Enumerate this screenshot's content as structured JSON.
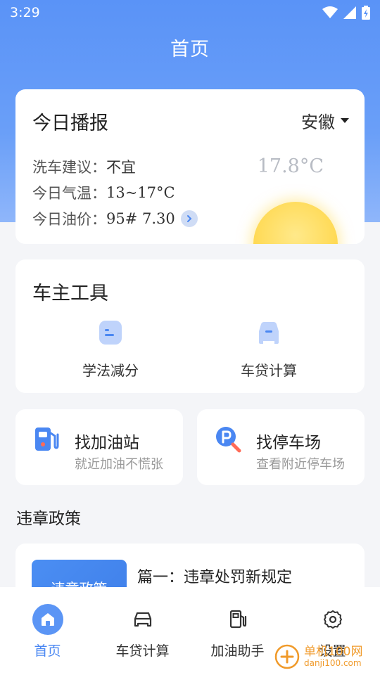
{
  "status_bar": {
    "time": "3:29"
  },
  "header": {
    "title": "首页"
  },
  "report": {
    "title": "今日播报",
    "region": "安徽",
    "wash_label": "洗车建议：",
    "wash_value": "不宜",
    "weather_label": "今日气温：",
    "weather_value": "13~17°C",
    "oil_label": "今日油价：",
    "oil_value": "95# 7.30",
    "temperature": "17.8°C"
  },
  "tools": {
    "title": "车主工具",
    "items": [
      {
        "label": "学法减分",
        "icon": "document-icon"
      },
      {
        "label": "车贷计算",
        "icon": "car-icon"
      }
    ]
  },
  "quick_links": [
    {
      "title": "找加油站",
      "subtitle": "就近加油不慌张",
      "icon": "gas-station-icon"
    },
    {
      "title": "找停车场",
      "subtitle": "查看附近停车场",
      "icon": "parking-search-icon"
    }
  ],
  "policy": {
    "section_title": "违章政策",
    "items": [
      {
        "thumb_text": "违章政策",
        "title": "篇一：违章处罚新规定"
      }
    ]
  },
  "tabbar": {
    "items": [
      {
        "label": "首页",
        "icon": "home-icon",
        "active": true
      },
      {
        "label": "车贷计算",
        "icon": "car-icon"
      },
      {
        "label": "加油助手",
        "icon": "gas-pump-icon"
      },
      {
        "label": "设置",
        "icon": "gear-icon"
      }
    ]
  },
  "watermark": {
    "name": "单机100网",
    "url": "danji100.com"
  },
  "colors": {
    "primary": "#5b95f5",
    "accent_text": "#4a87f2",
    "sun": "#ffd84f"
  }
}
